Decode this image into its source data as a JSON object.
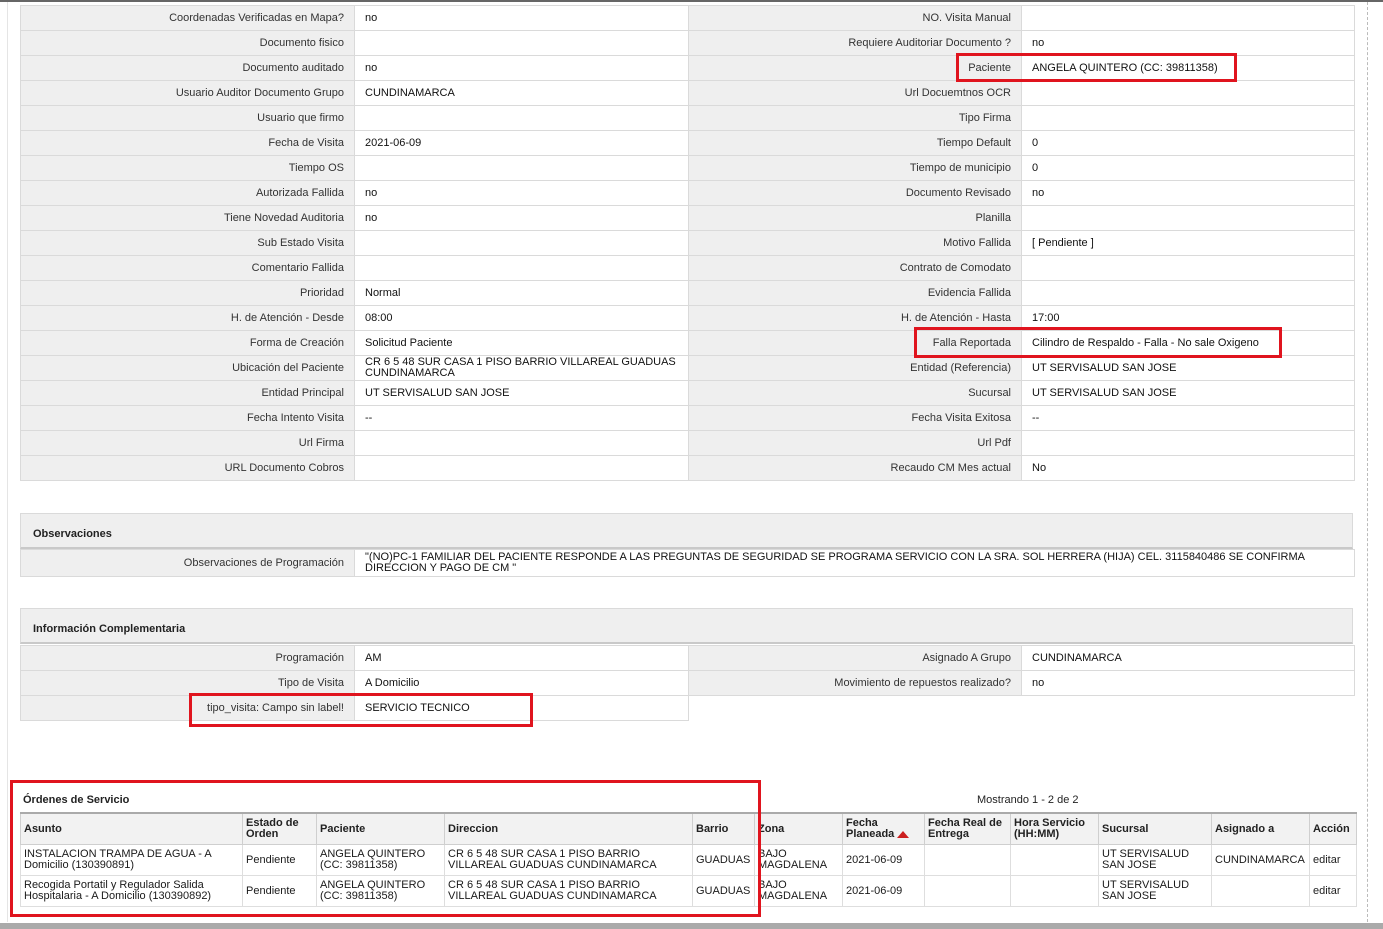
{
  "visit_details": {
    "rows": [
      {
        "l_label": "Coordenadas Verificadas en Mapa?",
        "l_value": "no",
        "r_label": "NO. Visita Manual",
        "r_value": ""
      },
      {
        "l_label": "Documento fisico",
        "l_value": "",
        "r_label": "Requiere Auditoriar Documento ?",
        "r_value": "no"
      },
      {
        "l_label": "Documento auditado",
        "l_value": "no",
        "r_label": "Paciente",
        "r_value": "ANGELA QUINTERO (CC: 39811358)"
      },
      {
        "l_label": "Usuario Auditor Documento Grupo",
        "l_value": "CUNDINAMARCA",
        "r_label": "Url Docuemtnos OCR",
        "r_value": ""
      },
      {
        "l_label": "Usuario que firmo",
        "l_value": "",
        "r_label": "Tipo Firma",
        "r_value": ""
      },
      {
        "l_label": "Fecha de Visita",
        "l_value": "2021-06-09",
        "r_label": "Tiempo Default",
        "r_value": "0"
      },
      {
        "l_label": "Tiempo OS",
        "l_value": "",
        "r_label": "Tiempo de municipio",
        "r_value": "0"
      },
      {
        "l_label": "Autorizada Fallida",
        "l_value": "no",
        "r_label": "Documento Revisado",
        "r_value": "no"
      },
      {
        "l_label": "Tiene Novedad Auditoria",
        "l_value": "no",
        "r_label": "Planilla",
        "r_value": ""
      },
      {
        "l_label": "Sub Estado Visita",
        "l_value": "",
        "r_label": "Motivo Fallida",
        "r_value": "[ Pendiente ]"
      },
      {
        "l_label": "Comentario Fallida",
        "l_value": "",
        "r_label": "Contrato de Comodato",
        "r_value": ""
      },
      {
        "l_label": "Prioridad",
        "l_value": "Normal",
        "r_label": "Evidencia Fallida",
        "r_value": ""
      },
      {
        "l_label": "H. de Atención - Desde",
        "l_value": "08:00",
        "r_label": "H. de Atención - Hasta",
        "r_value": "17:00"
      },
      {
        "l_label": "Forma de Creación",
        "l_value": "Solicitud Paciente",
        "r_label": "Falla Reportada",
        "r_value": "Cilindro de Respaldo - Falla - No sale Oxigeno"
      },
      {
        "l_label": "Ubicación del Paciente",
        "l_value": "CR 6 5 48 SUR CASA 1 PISO BARRIO VILLAREAL GUADUAS CUNDINAMARCA",
        "r_label": "Entidad (Referencia)",
        "r_value": "UT SERVISALUD SAN JOSE"
      },
      {
        "l_label": "Entidad Principal",
        "l_value": "UT SERVISALUD SAN JOSE",
        "r_label": "Sucursal",
        "r_value": "UT SERVISALUD SAN JOSE"
      },
      {
        "l_label": "Fecha Intento Visita",
        "l_value": "--",
        "r_label": "Fecha Visita Exitosa",
        "r_value": "--"
      },
      {
        "l_label": "Url Firma",
        "l_value": "",
        "r_label": "Url Pdf",
        "r_value": ""
      },
      {
        "l_label": "URL Documento Cobros",
        "l_value": "",
        "r_label": "Recaudo CM Mes actual",
        "r_value": "No"
      }
    ]
  },
  "observaciones": {
    "title": "Observaciones",
    "label": "Observaciones de Programación",
    "value": "\"(NO)PC-1 FAMILIAR DEL PACIENTE RESPONDE A LAS PREGUNTAS DE SEGURIDAD SE PROGRAMA SERVICIO CON LA SRA. SOL HERRERA (HIJA) CEL. 3115840486 SE CONFIRMA DIRECCION Y PAGO DE CM \""
  },
  "info_complementaria": {
    "title": "Información Complementaria",
    "rows": [
      {
        "l_label": "Programación",
        "l_value": "AM",
        "r_label": "Asignado A Grupo",
        "r_value": "CUNDINAMARCA"
      },
      {
        "l_label": "Tipo de Visita",
        "l_value": "A Domicilio",
        "r_label": "Movimiento de repuestos realizado?",
        "r_value": "no"
      },
      {
        "l_label": "tipo_visita: Campo sin label!",
        "l_value": "SERVICIO TECNICO"
      }
    ]
  },
  "ordenes": {
    "title": "Órdenes de Servicio",
    "count_text": "Mostrando 1 - 2 de 2",
    "columns": [
      "Asunto",
      "Estado de Orden",
      "Paciente",
      "Direccion",
      "Barrio",
      "Zona",
      "Fecha Planeada",
      "Fecha Real de Entrega",
      "Hora Servicio (HH:MM)",
      "Sucursal",
      "Asignado a",
      "Acción"
    ],
    "rows": [
      {
        "asunto": "INSTALACION TRAMPA DE AGUA - A Domicilio (130390891)",
        "estado": "Pendiente",
        "paciente": "ANGELA QUINTERO (CC: 39811358)",
        "direccion": "CR 6 5 48 SUR CASA 1 PISO BARRIO VILLAREAL GUADUAS CUNDINAMARCA",
        "barrio": "GUADUAS",
        "zona": "BAJO MAGDALENA",
        "fecha_planeada": "2021-06-09",
        "fecha_real": "",
        "hora": "",
        "sucursal": "UT SERVISALUD SAN JOSE",
        "asignado": "CUNDINAMARCA",
        "accion": "editar"
      },
      {
        "asunto": "Recogida Portatil y Regulador Salida Hospitalaria - A Domicilio (130390892)",
        "estado": "Pendiente",
        "paciente": "ANGELA QUINTERO (CC: 39811358)",
        "direccion": "CR 6 5 48 SUR CASA 1 PISO BARRIO VILLAREAL GUADUAS CUNDINAMARCA",
        "barrio": "GUADUAS",
        "zona": "BAJO MAGDALENA",
        "fecha_planeada": "2021-06-09",
        "fecha_real": "",
        "hora": "",
        "sucursal": "UT SERVISALUD SAN JOSE",
        "asignado": "",
        "accion": "editar"
      }
    ]
  },
  "colors": {
    "highlight": "#e0141e",
    "label_bg": "#efefef",
    "sort_arrow": "#cc1f1f"
  }
}
